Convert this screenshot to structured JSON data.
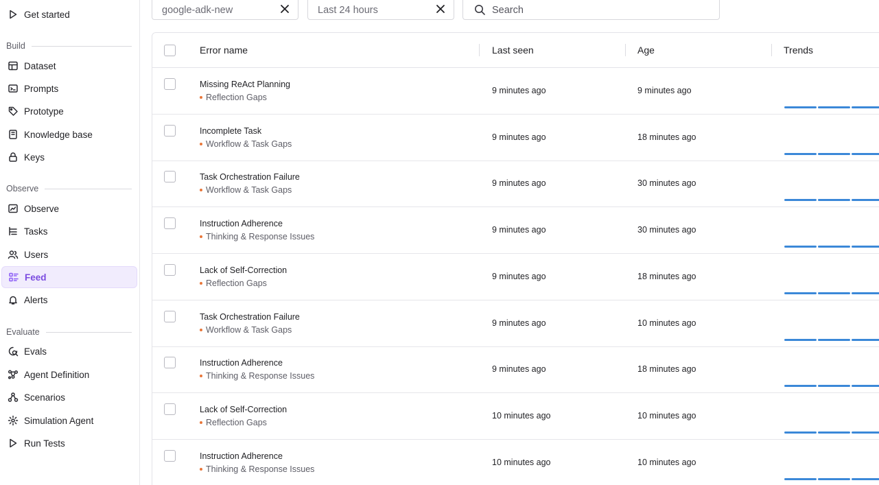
{
  "sidebar": {
    "get_started": "Get started",
    "sections": {
      "build": "Build",
      "observe": "Observe",
      "evaluate": "Evaluate"
    },
    "items": {
      "dataset": "Dataset",
      "prompts": "Prompts",
      "prototype": "Prototype",
      "knowledge_base": "Knowledge base",
      "keys": "Keys",
      "observe": "Observe",
      "tasks": "Tasks",
      "users": "Users",
      "feed": "Feed",
      "alerts": "Alerts",
      "evals": "Evals",
      "agent_definition": "Agent Definition",
      "scenarios": "Scenarios",
      "simulation_agent": "Simulation Agent",
      "run_tests": "Run Tests"
    },
    "active_item": "feed",
    "accent_color": "#8b5cf6"
  },
  "filters": {
    "project": "google-adk-new",
    "time_range": "Last 24 hours",
    "search_placeholder": "Search"
  },
  "table": {
    "headers": {
      "error_name": "Error name",
      "last_seen": "Last seen",
      "age": "Age",
      "trends": "Trends"
    },
    "rows": [
      {
        "name": "Missing ReAct Planning",
        "category": "Reflection Gaps",
        "last_seen": "9 minutes ago",
        "age": "9 minutes ago"
      },
      {
        "name": "Incomplete Task",
        "category": "Workflow & Task Gaps",
        "last_seen": "9 minutes ago",
        "age": "18 minutes ago"
      },
      {
        "name": "Task Orchestration Failure",
        "category": "Workflow & Task Gaps",
        "last_seen": "9 minutes ago",
        "age": "30 minutes ago"
      },
      {
        "name": "Instruction Adherence",
        "category": "Thinking & Response Issues",
        "last_seen": "9 minutes ago",
        "age": "30 minutes ago"
      },
      {
        "name": "Lack of Self-Correction",
        "category": "Reflection Gaps",
        "last_seen": "9 minutes ago",
        "age": "18 minutes ago"
      },
      {
        "name": "Task Orchestration Failure",
        "category": "Workflow & Task Gaps",
        "last_seen": "9 minutes ago",
        "age": "10 minutes ago"
      },
      {
        "name": "Instruction Adherence",
        "category": "Thinking & Response Issues",
        "last_seen": "9 minutes ago",
        "age": "18 minutes ago"
      },
      {
        "name": "Lack of Self-Correction",
        "category": "Reflection Gaps",
        "last_seen": "10 minutes ago",
        "age": "10 minutes ago"
      },
      {
        "name": "Instruction Adherence",
        "category": "Thinking & Response Issues",
        "last_seen": "10 minutes ago",
        "age": "10 minutes ago"
      }
    ],
    "category_dot_color": "#e8773a",
    "trend_color": "#3b88d8"
  }
}
